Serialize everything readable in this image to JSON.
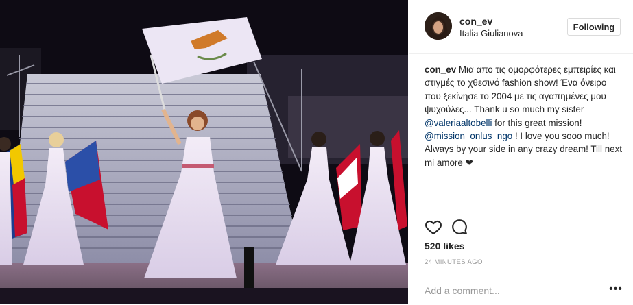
{
  "post": {
    "username": "con_ev",
    "location": "Italia Giulianova",
    "follow_label": "Following",
    "caption": {
      "user": "con_ev",
      "text_1": " Μια απο τις ομορφότερες εμπειρίες και στιγμές το χθεσινό fashion show! Ένα όνειρο που ξεκίνησε το 2004 με τις αγαπημένες μου ψυχούλες... Thank u so much my sister ",
      "mention_1": "@valeriaaltobelli",
      "text_2": " for this great mission! ",
      "mention_2": "@mission_onlus_ngo",
      "text_3": " ! I love you sooo much! Always by your side in any crazy dream! Till next mi amore ❤"
    },
    "likes": "520 likes",
    "timestamp": "24 MINUTES AGO",
    "comment_placeholder": "Add a comment...",
    "more_label": "•••"
  },
  "icons": {
    "like": "heart-icon",
    "comment": "speech-bubble-icon",
    "more": "ellipsis-icon"
  },
  "colors": {
    "mention": "#003569",
    "muted": "#999999",
    "border": "#efefef"
  }
}
